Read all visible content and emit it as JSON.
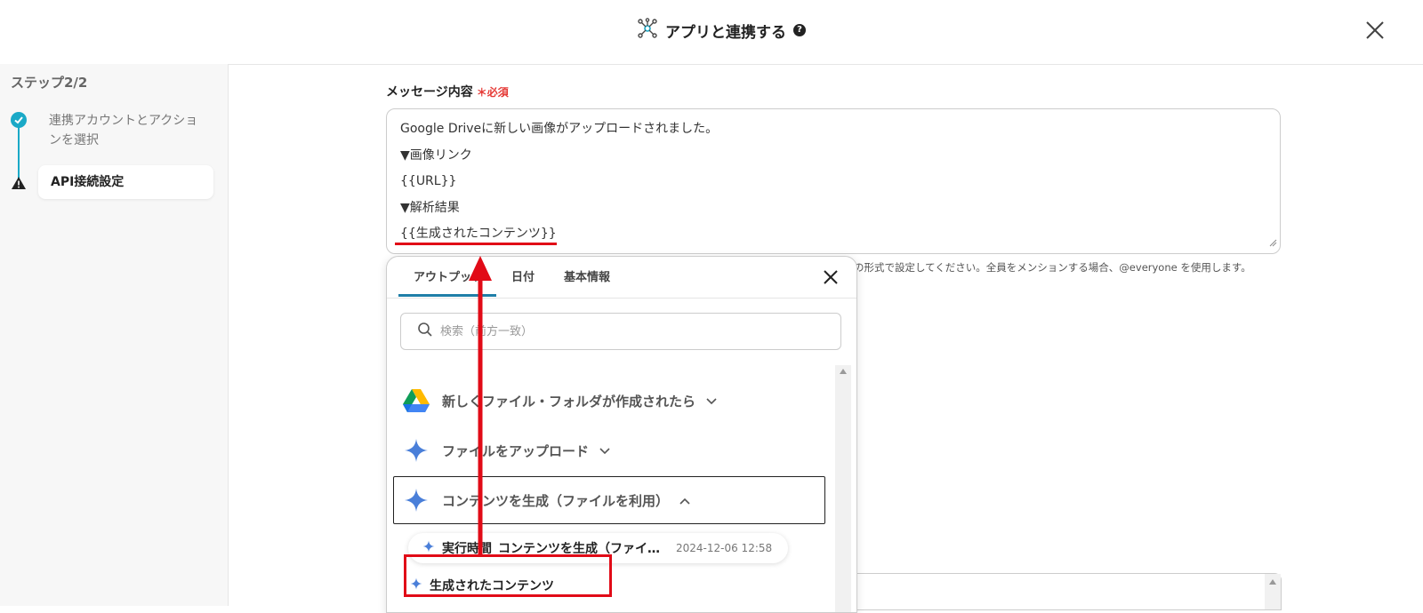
{
  "header": {
    "title": "アプリと連携する"
  },
  "sidebar": {
    "step_label": "ステップ2/2",
    "steps": [
      {
        "label": "連携アカウントとアクションを選択",
        "status": "done"
      },
      {
        "label": "API接続設定",
        "status": "warning"
      }
    ]
  },
  "message_field": {
    "label": "メッセージ内容",
    "required": "必須",
    "lines": [
      "Google Driveに新しい画像がアップロードされました。",
      "▼画像リンク",
      "{{URL}}",
      "▼解析結果",
      "{{生成されたコンテンツ}}"
    ],
    "hint": "の形式で設定してください。全員をメンションする場合、@everyone を使用します。"
  },
  "popup": {
    "tabs": [
      "アウトプット",
      "日付",
      "基本情報"
    ],
    "active_tab": "アウトプット",
    "search_placeholder": "検索（前方一致）",
    "groups": [
      {
        "label": "新しくファイル・フォルダが作成されたら",
        "icon": "google-drive-icon",
        "expanded": false
      },
      {
        "label": "ファイルをアップロード",
        "icon": "gemini-sparkle-icon",
        "expanded": false
      },
      {
        "label": "コンテンツを生成（ファイルを利用）",
        "icon": "gemini-sparkle-icon",
        "expanded": true
      }
    ],
    "outputs": [
      {
        "label": "実行時間_コンテンツを生成（ファイ…",
        "date": "2024-12-06 12:58"
      },
      {
        "label": "生成されたコンテンツ"
      }
    ]
  },
  "colors": {
    "accent": "#1aa9c7",
    "annotation_red": "#e10b17",
    "tab_underline": "#1f7fa8"
  }
}
